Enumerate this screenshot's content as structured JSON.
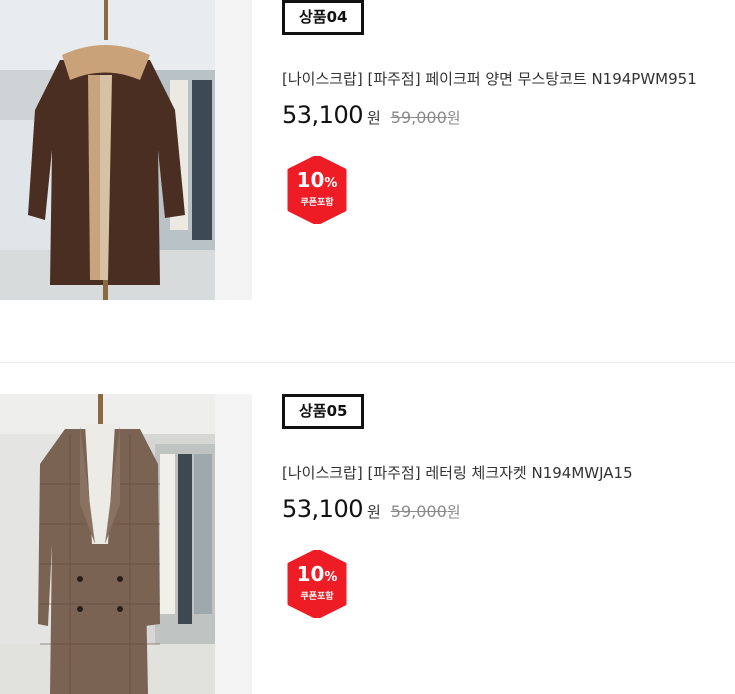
{
  "products": [
    {
      "badge": "상품04",
      "title": "[나이스크랍] [파주점] 페이크퍼 양면 무스탕코트 N194PWM951",
      "price": "53,100",
      "currency": "원",
      "original_price": "59,000",
      "original_currency": "원",
      "coupon_percent": "10",
      "coupon_symbol": "%",
      "coupon_label": "쿠폰포함"
    },
    {
      "badge": "상품05",
      "title": "[나이스크랍] [파주점] 레터링 체크자켓 N194MWJA15",
      "price": "53,100",
      "currency": "원",
      "original_price": "59,000",
      "original_currency": "원",
      "coupon_percent": "10",
      "coupon_symbol": "%",
      "coupon_label": "쿠폰포함"
    }
  ],
  "colors": {
    "coupon_red": "#ee1c25",
    "badge_border": "#111111"
  }
}
